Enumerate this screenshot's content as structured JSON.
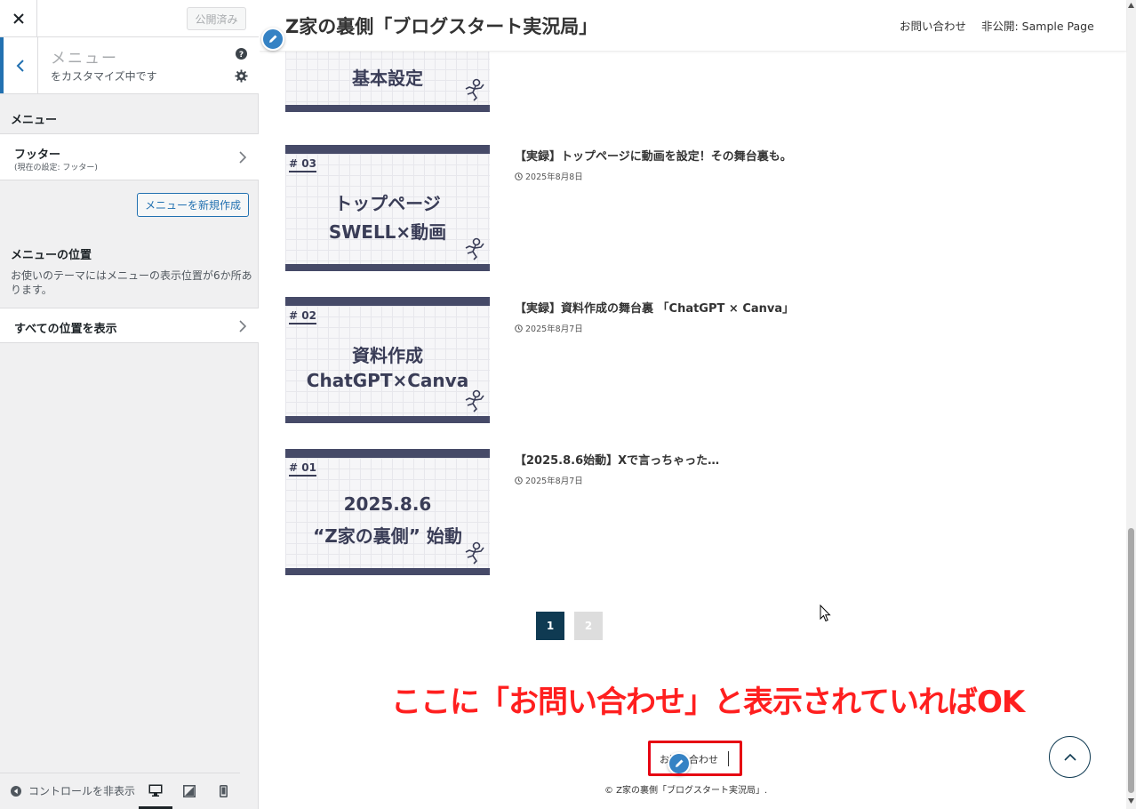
{
  "panel": {
    "publish_label": "公開済み",
    "section_title": "メニュー",
    "section_subtitle": "をカスタマイズ中です",
    "menus_heading": "メニュー",
    "footer_menu": {
      "label": "フッター",
      "current": "(現在の設定: フッター)"
    },
    "new_menu_button": "メニューを新規作成",
    "positions_heading": "メニューの位置",
    "positions_desc": "お使いのテーマにはメニューの表示位置が6か所あります。",
    "show_all_positions": "すべての位置を表示",
    "hide_controls": "コントロールを非表示"
  },
  "site": {
    "title": "Z家の裏側「ブログスタート実況局」",
    "nav": [
      "お問い合わせ",
      "非公開: Sample Page"
    ]
  },
  "posts": [
    {
      "num": "",
      "thumb_line1": "基本設定",
      "thumb_line2": "",
      "title": "",
      "date": ""
    },
    {
      "num": "# 03",
      "thumb_line1": "トップページ",
      "thumb_line2": "SWELL×動画",
      "title": "【実録】トップページに動画を設定！その舞台裏も。",
      "date": "2025年8月8日"
    },
    {
      "num": "# 02",
      "thumb_line1": "資料作成",
      "thumb_line2": "ChatGPT×Canva",
      "title": "【実録】資料作成の舞台裏 「ChatGPT × Canva」",
      "date": "2025年8月7日"
    },
    {
      "num": "# 01",
      "thumb_line1": "2025.8.6",
      "thumb_line2": "“Z家の裏側” 始動",
      "title": "【2025.8.6始動】Xで言っちゃった…",
      "date": "2025年8月7日"
    }
  ],
  "pagination": [
    "1",
    "2"
  ],
  "annotation": "ここに「お問い合わせ」と表示されていればOK",
  "footer": {
    "menu_link": "お問い合わせ",
    "copyright": "© Z家の裏側「ブログスタート実況局」."
  },
  "colors": {
    "accent": "#2271b1",
    "pagination_active": "#0f3a52",
    "annotation": "#ff1f1f",
    "thumb_frame": "#464a68"
  }
}
